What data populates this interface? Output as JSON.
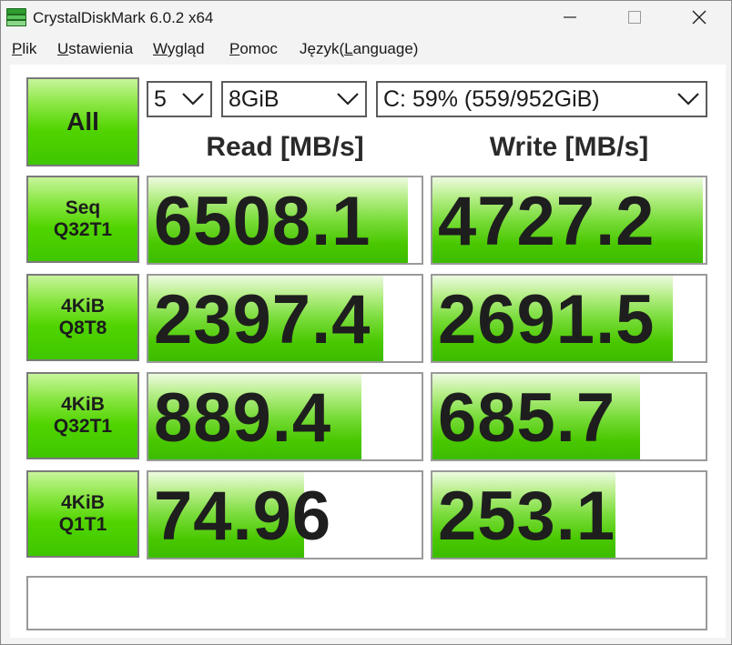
{
  "window": {
    "title": "CrystalDiskMark 6.0.2 x64"
  },
  "menu": [
    {
      "label": "Plik",
      "accel_index": 0
    },
    {
      "label": "Ustawienia",
      "accel_index": 0
    },
    {
      "label": "Wygląd",
      "accel_index": 0
    },
    {
      "label": "Pomoc",
      "accel_index": 0
    },
    {
      "label": "Język(Language)",
      "accel_index": 6
    }
  ],
  "controls": {
    "all_label": "All",
    "count_value": "5",
    "size_value": "8GiB",
    "drive_value": "C: 59% (559/952GiB)"
  },
  "headers": {
    "read": "Read [MB/s]",
    "write": "Write [MB/s]"
  },
  "tests": [
    {
      "line1": "Seq",
      "line2": "Q32T1",
      "read": "6508.1",
      "write": "4727.2",
      "read_fill": 0.95,
      "write_fill": 0.99
    },
    {
      "line1": "4KiB",
      "line2": "Q8T8",
      "read": "2397.4",
      "write": "2691.5",
      "read_fill": 0.86,
      "write_fill": 0.88
    },
    {
      "line1": "4KiB",
      "line2": "Q32T1",
      "read": "889.4",
      "write": "685.7",
      "read_fill": 0.78,
      "write_fill": 0.76
    },
    {
      "line1": "4KiB",
      "line2": "Q1T1",
      "read": "74.96",
      "write": "253.1",
      "read_fill": 0.57,
      "write_fill": 0.67
    }
  ],
  "status_text": "",
  "colors": {
    "accent": "#4fd000",
    "text": "#1e1e1e",
    "border": "#9a9a9a"
  }
}
